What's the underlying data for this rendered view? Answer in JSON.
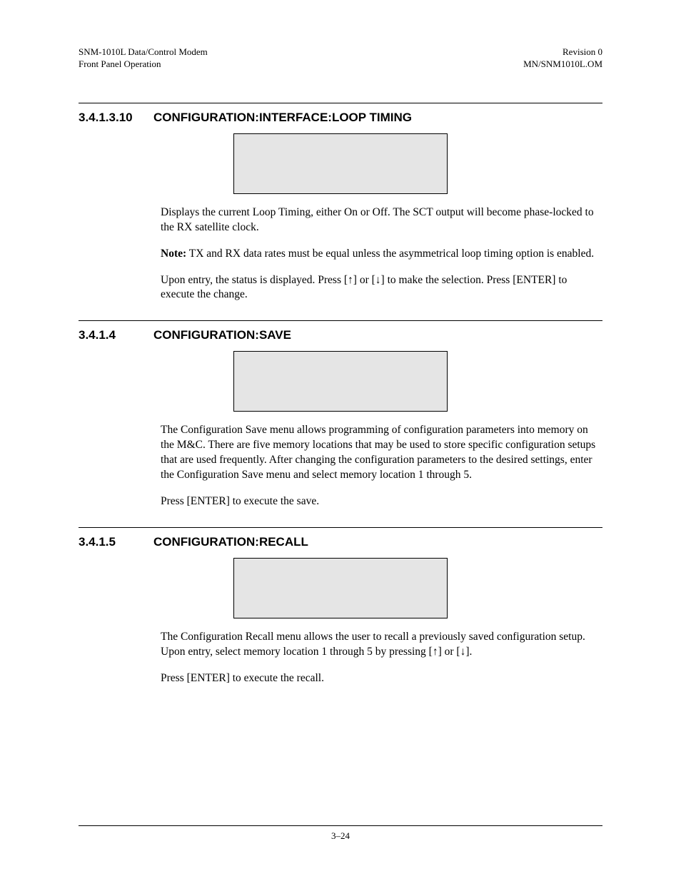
{
  "header": {
    "left_line1": "SNM-1010L Data/Control Modem",
    "left_line2": "Front Panel Operation",
    "right_line1": "Revision 0",
    "right_line2": "MN/SNM1010L.OM"
  },
  "sections": {
    "s1": {
      "number": "3.4.1.3.10",
      "title": "CONFIGURATION:INTERFACE:LOOP TIMING",
      "p1": "Displays the current Loop Timing, either On or Off. The SCT output will become phase-locked to the RX satellite clock.",
      "note_label": "Note:",
      "note_text": " TX and RX data rates must be equal unless the asymmetrical loop timing option is enabled.",
      "p3a": "Upon entry, the status is displayed. Press [",
      "p3b": "] or [",
      "p3c": "] to make the selection. Press [ENTER] to execute the change."
    },
    "s2": {
      "number": "3.4.1.4",
      "title": "CONFIGURATION:SAVE",
      "p1": "The Configuration Save menu allows programming of configuration parameters into memory on the M&C. There are five memory locations that may be used to store specific configuration setups that are used frequently. After changing the configuration parameters to the desired settings, enter the Configuration Save menu and select memory location 1 through 5.",
      "p2": "Press [ENTER] to execute the save."
    },
    "s3": {
      "number": "3.4.1.5",
      "title": "CONFIGURATION:RECALL",
      "p1a": "The Configuration Recall menu allows the user to recall a previously saved configuration setup. Upon entry, select memory location 1 through 5 by pressing [",
      "p1b": "] or [",
      "p1c": "].",
      "p2": "Press [ENTER] to execute the recall."
    }
  },
  "arrows": {
    "up": "↑",
    "down": "↓"
  },
  "footer": {
    "page": "3–24"
  }
}
